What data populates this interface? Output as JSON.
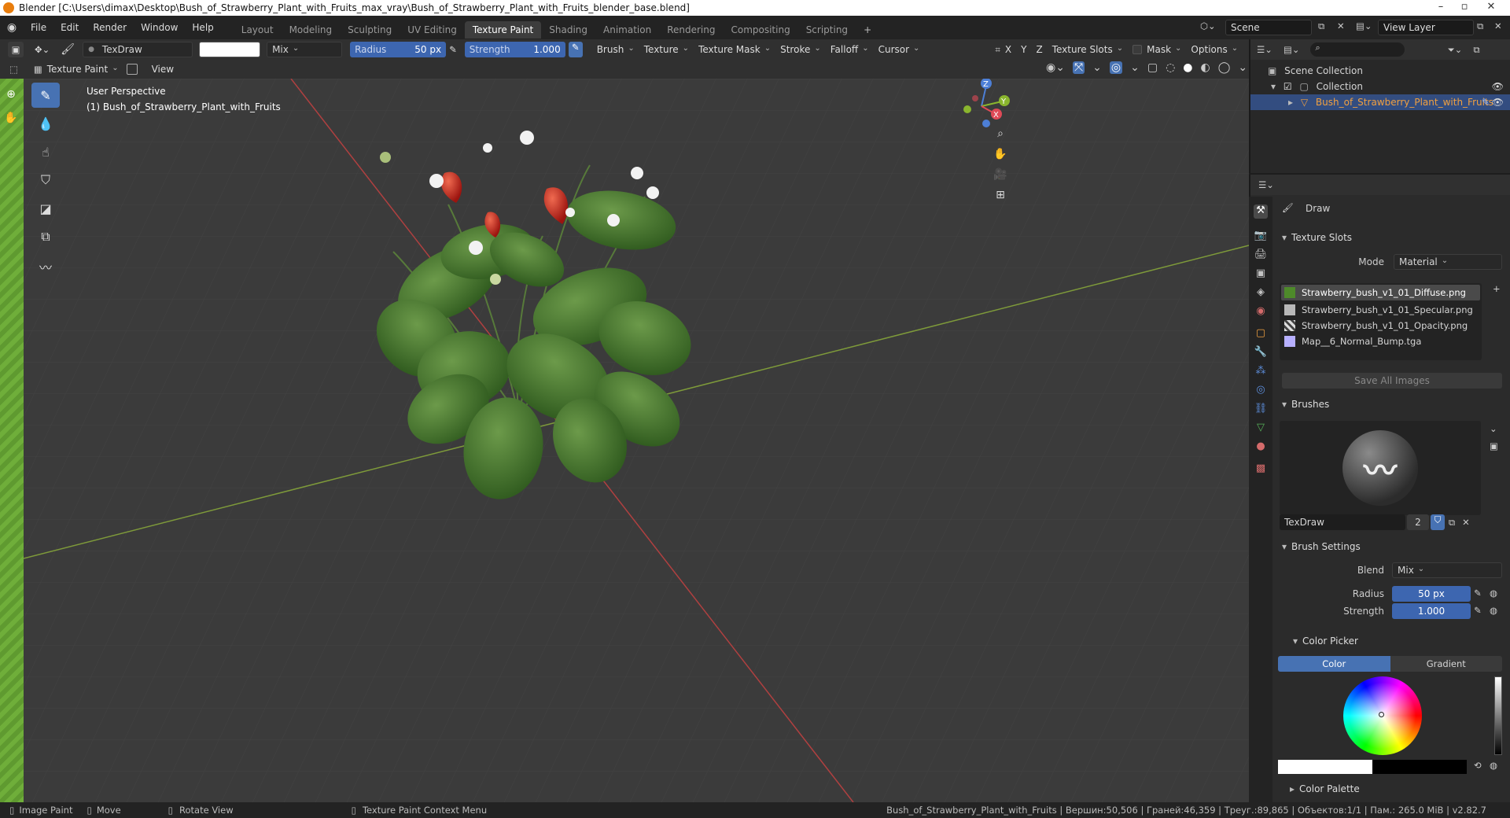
{
  "titlebar": {
    "title": "Blender [C:\\Users\\dimax\\Desktop\\Bush_of_Strawberry_Plant_with_Fruits_max_vray\\Bush_of_Strawberry_Plant_with_Fruits_blender_base.blend]",
    "minimize": "–",
    "maximize": "▫",
    "close": "✕"
  },
  "menubar": {
    "items": [
      "File",
      "Edit",
      "Render",
      "Window",
      "Help"
    ],
    "workspaces": [
      "Layout",
      "Modeling",
      "Sculpting",
      "UV Editing",
      "Texture Paint",
      "Shading",
      "Animation",
      "Rendering",
      "Compositing",
      "Scripting"
    ],
    "active_workspace": "Texture Paint",
    "add_tab": "+",
    "scene": "Scene",
    "view_layer": "View Layer"
  },
  "toolheader": {
    "brush_name": "TexDraw",
    "blend": "Mix",
    "radius_label": "Radius",
    "radius_value": "50 px",
    "strength_label": "Strength",
    "strength_value": "1.000",
    "menus": [
      "Brush",
      "Texture",
      "Texture Mask",
      "Stroke",
      "Falloff",
      "Cursor"
    ],
    "axes": [
      "X",
      "Y",
      "Z"
    ],
    "texture_slots": "Texture Slots",
    "mask": "Mask",
    "options": "Options"
  },
  "header2": {
    "mode": "Texture Paint",
    "view": "View"
  },
  "viewport": {
    "perspective": "User Perspective",
    "object_label": "(1) Bush_of_Strawberry_Plant_with_Fruits",
    "gizmo": {
      "z": "Z",
      "y": "Y",
      "x": "X"
    }
  },
  "outliner": {
    "scene_collection": "Scene Collection",
    "collection": "Collection",
    "object": "Bush_of_Strawberry_Plant_with_Fruits"
  },
  "properties": {
    "tool_name": "Draw",
    "texture_slots_title": "Texture Slots",
    "mode_label": "Mode",
    "mode_value": "Material",
    "slots": [
      {
        "name": "Strawberry_bush_v1_01_Diffuse.png",
        "color": "#4e8a2a",
        "selected": true
      },
      {
        "name": "Strawberry_bush_v1_01_Specular.png",
        "color": "#b8b8b8",
        "selected": false
      },
      {
        "name": "Strawberry_bush_v1_01_Opacity.png",
        "color": "#777777",
        "selected": false
      },
      {
        "name": "Map__6_Normal_Bump.tga",
        "color": "#b7b0ff",
        "selected": false
      }
    ],
    "save_all": "Save All Images",
    "brushes_title": "Brushes",
    "brush_name": "TexDraw",
    "brush_users": "2",
    "brush_settings_title": "Brush Settings",
    "blend_label": "Blend",
    "blend_value": "Mix",
    "radius_label": "Radius",
    "radius_value": "50 px",
    "strength_label": "Strength",
    "strength_value": "1.000",
    "color_picker_title": "Color Picker",
    "color_tab": "Color",
    "gradient_tab": "Gradient",
    "color_palette_title": "Color Palette"
  },
  "statusbar": {
    "left": [
      {
        "icon": "mouse-left-icon",
        "label": "Image Paint"
      },
      {
        "icon": "mouse-move-icon",
        "label": "Move"
      },
      {
        "icon": "mouse-middle-icon",
        "label": "Rotate View"
      },
      {
        "icon": "mouse-right-icon",
        "label": "Texture Paint Context Menu"
      }
    ],
    "right": "Bush_of_Strawberry_Plant_with_Fruits | Вершин:50,506 | Граней:46,359 | Треуг.:89,865 | Объектов:1/1 | Пам.: 265.0 MiB | v2.82.7"
  },
  "colors": {
    "accent_blue": "#4772b3",
    "slider_blue": "#3d66b0",
    "selection": "#334d80",
    "leaf_green": "#3f6f2a",
    "strawberry_red": "#c4241c"
  }
}
